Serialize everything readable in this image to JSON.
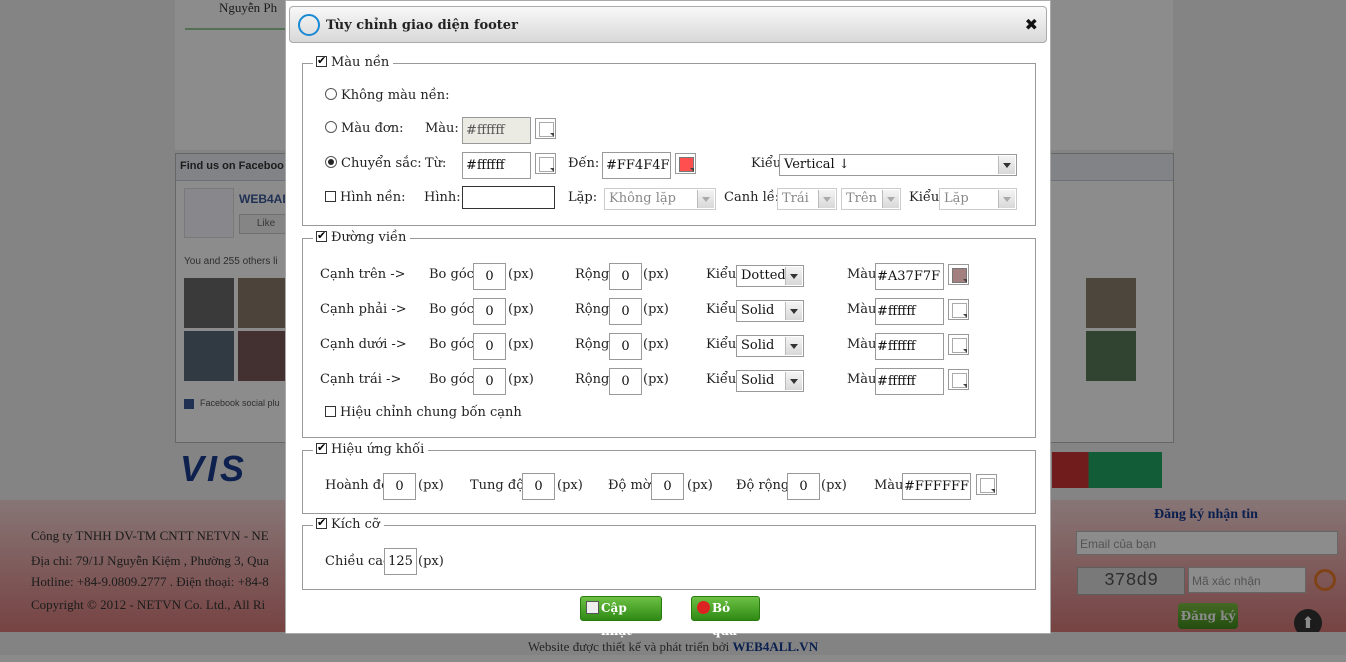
{
  "background": {
    "author": "Nguyễn Ph",
    "fb_title": "Find us on Faceboo",
    "fb_name": "WEB4AL",
    "fb_like": "Like",
    "fb_others": "You and 255 others li",
    "fb_plugin": "Facebook social plu",
    "visa": "VIS",
    "footer_lines": [
      "Công ty TNHH DV-TM CNTT NETVN - NE",
      "Địa chỉ: 79/1J Nguyễn Kiệm , Phường 3, Qua",
      "Hotline: +84-9.0809.2777 . Điện thoại: +84-8",
      "Copyright © 2012 - NETVN Co. Ltd., All Ri"
    ],
    "newsletter_title": "Đăng ký nhận tin",
    "email_placeholder": "Email của bạn",
    "captcha_text": "378d9",
    "code_placeholder": "Mã xác nhận",
    "signup_label": "Đăng ký",
    "credit_prefix": "Website được thiết kế và phát triển bởi ",
    "credit_brand": "WEB4ALL.VN"
  },
  "dialog": {
    "title": "Tùy chỉnh giao diện footer",
    "close_icon": "close-icon",
    "background": {
      "legend": "Màu nền",
      "enabled": true,
      "none_label": "Không màu nền:",
      "solid_label": "Màu đơn:",
      "solid_color_label": "Màu:",
      "solid_color_value": "#ffffff",
      "gradient_label": "Chuyển sắc:",
      "from_label": "Từ:",
      "from_value": "#ffffff",
      "from_swatch": "#ffffff",
      "to_label": "Đến:",
      "to_value": "#FF4F4F",
      "to_swatch": "#FF4F4F",
      "kind_label": "Kiểu:",
      "kind_value": "Vertical ↓",
      "selected_mode": "gradient",
      "image_label": "Hình nền:",
      "image_checked": false,
      "image_field_label": "Hình:",
      "image_value": "",
      "repeat_label": "Lặp:",
      "repeat_value": "Không lặp",
      "align_label": "Canh lề:",
      "align_h_value": "Trái",
      "align_v_value": "Trên",
      "style_label": "Kiểu",
      "style_value": "Lặp"
    },
    "border": {
      "legend": "Đường viền",
      "enabled": true,
      "radius_label": "Bo góc:",
      "width_label": "Rộng:",
      "unit": "(px)",
      "style_label": "Kiểu:",
      "color_label": "Màu:",
      "sides": [
        {
          "label": "Cạnh trên ->",
          "radius": "0",
          "width": "0",
          "style": "Dotted",
          "color": "#A37F7F",
          "swatch": "#A37F7F"
        },
        {
          "label": "Cạnh phải ->",
          "radius": "0",
          "width": "0",
          "style": "Solid",
          "color": "#ffffff",
          "swatch": "#ffffff"
        },
        {
          "label": "Cạnh dưới ->",
          "radius": "0",
          "width": "0",
          "style": "Solid",
          "color": "#ffffff",
          "swatch": "#ffffff"
        },
        {
          "label": "Cạnh trái ->",
          "radius": "0",
          "width": "0",
          "style": "Solid",
          "color": "#ffffff",
          "swatch": "#ffffff"
        }
      ],
      "all_sides_label": "Hiệu chỉnh chung bốn cạnh",
      "all_sides_checked": false
    },
    "shadow": {
      "legend": "Hiệu ứng khối",
      "enabled": true,
      "x_label": "Hoành độ:",
      "x_value": "0",
      "y_label": "Tung độ:",
      "y_value": "0",
      "blur_label": "Độ mờ:",
      "blur_value": "0",
      "spread_label": "Độ rộng:",
      "spread_value": "0",
      "unit": "(px)",
      "color_label": "Màu:",
      "color_value": "#FFFFFF",
      "swatch": "#FFFFFF"
    },
    "size": {
      "legend": "Kích cỡ",
      "enabled": true,
      "height_label": "Chiều cao:",
      "height_value": "125",
      "unit": "(px)"
    },
    "update_label": "Cập nhật",
    "cancel_label": "Bỏ qua"
  }
}
